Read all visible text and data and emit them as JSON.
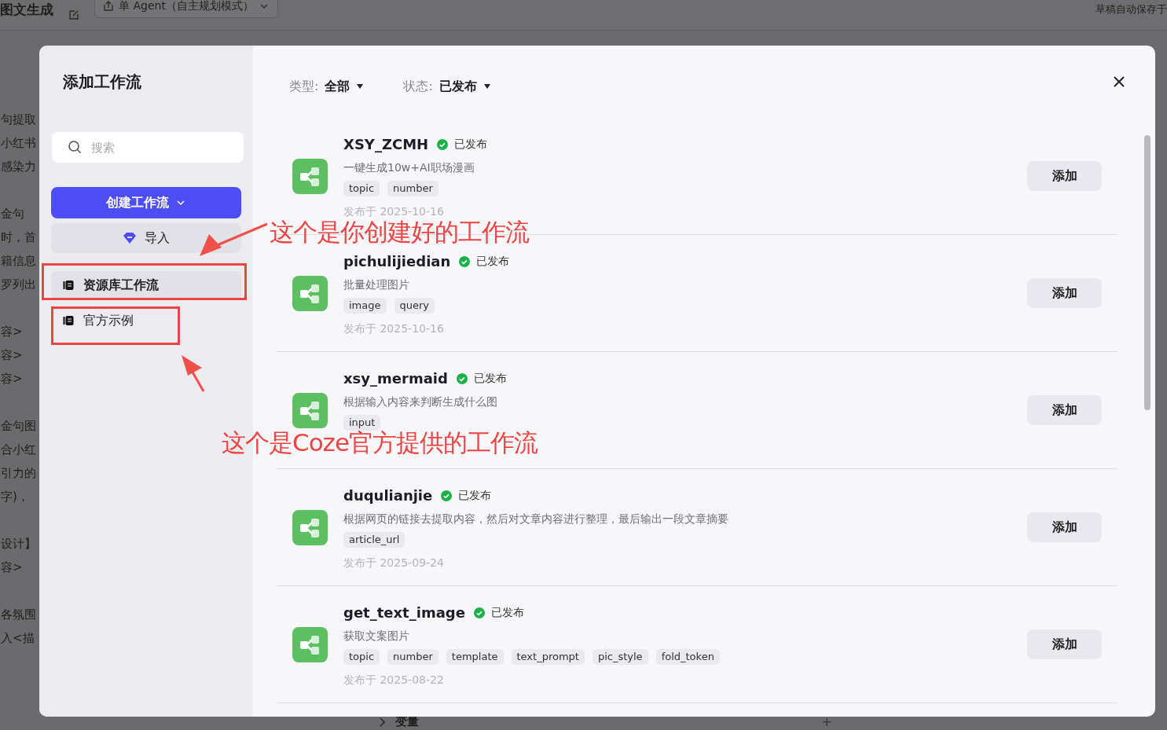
{
  "background": {
    "app_title": "图文生成",
    "agent_mode": "单 Agent（自主规划模式）",
    "autosave": "草稿自动保存于",
    "left_paragraphs": [
      [
        "句提取",
        "小红书",
        "感染力"
      ],
      [
        "金句",
        "时，首",
        "籍信息",
        "罗列出"
      ],
      [
        "容>",
        "容>",
        "容>"
      ],
      [
        "金句图",
        "合小红",
        "引力的",
        "字)，"
      ],
      [
        "设计】",
        "容>"
      ],
      [
        "各氛围",
        "入<描"
      ]
    ],
    "bottom_label": "变量",
    "bottom_add": "+"
  },
  "dialog": {
    "title": "添加工作流",
    "search": {
      "placeholder": "搜索"
    },
    "create_button": "创建工作流",
    "import_button": "导入",
    "nav": [
      {
        "label": "资源库工作流",
        "selected": true
      },
      {
        "label": "官方示例",
        "selected": false
      }
    ],
    "filters": [
      {
        "label": "类型:",
        "value": "全部"
      },
      {
        "label": "状态:",
        "value": "已发布"
      }
    ],
    "workflows": [
      {
        "name": "XSY_ZCMH",
        "status": "已发布",
        "description": "一键生成10w+AI职场漫画",
        "params": [
          "topic",
          "number"
        ],
        "date": "发布于 2025-10-16",
        "action": "添加"
      },
      {
        "name": "pichulijiedian",
        "status": "已发布",
        "description": "批量处理图片",
        "params": [
          "image",
          "query"
        ],
        "date": "发布于 2025-10-16",
        "action": "添加"
      },
      {
        "name": "xsy_mermaid",
        "status": "已发布",
        "description": "根据输入内容来判断生成什么图",
        "params": [
          "input"
        ],
        "action": "添加"
      },
      {
        "name": "duqulianjie",
        "status": "已发布",
        "description": "根据网页的链接去提取内容，然后对文章内容进行整理，最后输出一段文章摘要",
        "params": [
          "article_url"
        ],
        "date": "发布于 2025-09-24",
        "action": "添加"
      },
      {
        "name": "get_text_image",
        "status": "已发布",
        "description": "获取文案图片",
        "params": [
          "topic",
          "number",
          "template",
          "text_prompt",
          "pic_style",
          "fold_token"
        ],
        "date": "发布于 2025-08-22",
        "action": "添加"
      }
    ]
  },
  "annotations": [
    "这个是你创建好的工作流",
    "这个是Coze官方提供的工作流"
  ]
}
